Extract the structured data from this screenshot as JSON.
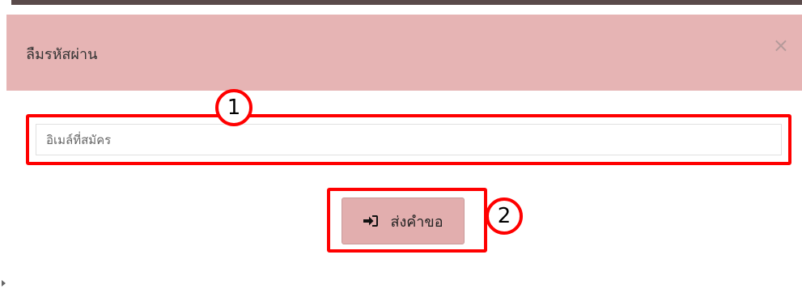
{
  "modal": {
    "title": "ลืมรหัสผ่าน",
    "close_symbol": "×"
  },
  "form": {
    "email_placeholder": "อิเมล์ที่สมัคร",
    "email_value": "",
    "submit_label": "ส่งคำขอ",
    "submit_icon": "sign-in-icon"
  },
  "annotations": {
    "callout_1": "1",
    "callout_2": "2",
    "highlight_color": "#ff0000"
  },
  "colors": {
    "header_bg": "#e6b4b4",
    "button_bg": "#e2aeae"
  }
}
